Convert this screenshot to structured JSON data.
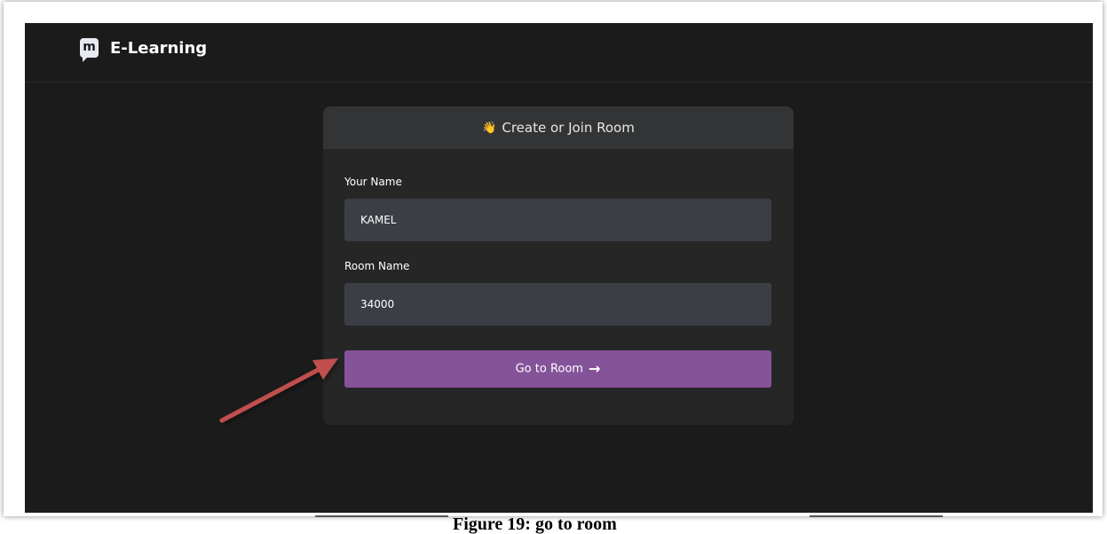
{
  "app": {
    "title": "E-Learning",
    "logo_letter": "m"
  },
  "card": {
    "header": "Create or Join Room",
    "header_icon": "waving-hand-icon",
    "your_name_label": "Your Name",
    "your_name_value": "KAMEL",
    "room_name_label": "Room Name",
    "room_name_value": "34000",
    "button_label": "Go to Room",
    "button_icon": "arrow-right-icon"
  },
  "caption": {
    "text": "Figure 19: go to room"
  },
  "colors": {
    "background": "#1b1b1b",
    "card": "#262626",
    "card_header": "#333436",
    "input": "#3b3e45",
    "button": "#845399",
    "annotation_arrow": "#c0504d"
  }
}
